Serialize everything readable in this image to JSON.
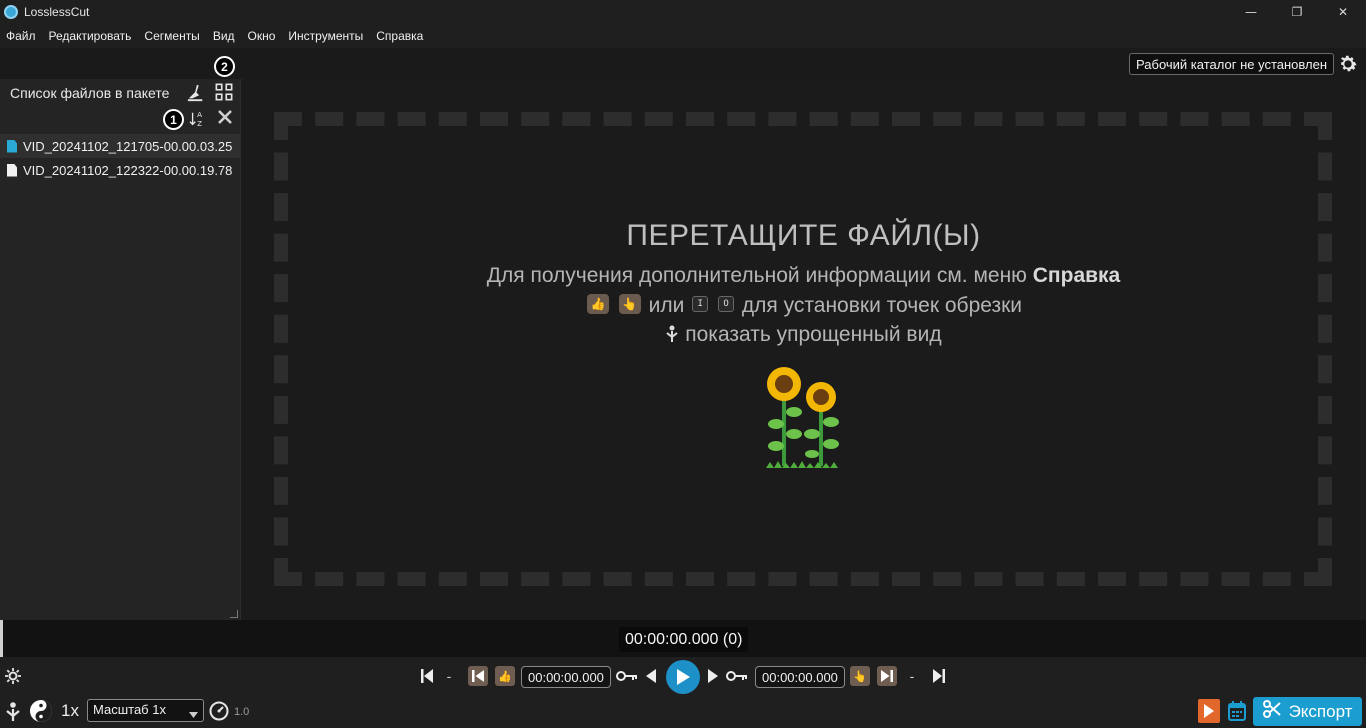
{
  "window": {
    "title": "LosslessCut",
    "minimize": "—",
    "maximize": "❐",
    "close": "✕"
  },
  "menu": [
    "Файл",
    "Редактировать",
    "Сегменты",
    "Вид",
    "Окно",
    "Инструменты",
    "Справка"
  ],
  "workdir": {
    "label": "Рабочий каталог не установлен"
  },
  "sidebar": {
    "title": "Список файлов в пакете",
    "badge1": "1",
    "badge2": "2",
    "files": [
      {
        "name": "VID_20241102_121705-00.00.03.25",
        "selected": true
      },
      {
        "name": "VID_20241102_122322-00.00.19.78",
        "selected": false
      }
    ]
  },
  "drop": {
    "title": "ПЕРЕТАЩИТЕ ФАЙЛ(Ы)",
    "help_prefix": "Для получения дополнительной информации см. меню ",
    "help_bold": "Справка",
    "or_text": "или",
    "key_i": "I",
    "key_o": "O",
    "cut_text": "для установки точек обрезки",
    "simple_view": "показать упрощенный вид"
  },
  "timeline": {
    "current_time": "00:00:00.000 (0)"
  },
  "controls": {
    "dash": "-",
    "start_time": "00:00:00.000",
    "end_time": "00:00:00.000",
    "speed": "1x",
    "zoom": "Масштаб 1x",
    "zoom_value": "1.0",
    "export": "Экспорт"
  },
  "colors": {
    "accent": "#1c9dcf",
    "segment": "#6f5d52",
    "export_orange": "#e2672a"
  }
}
